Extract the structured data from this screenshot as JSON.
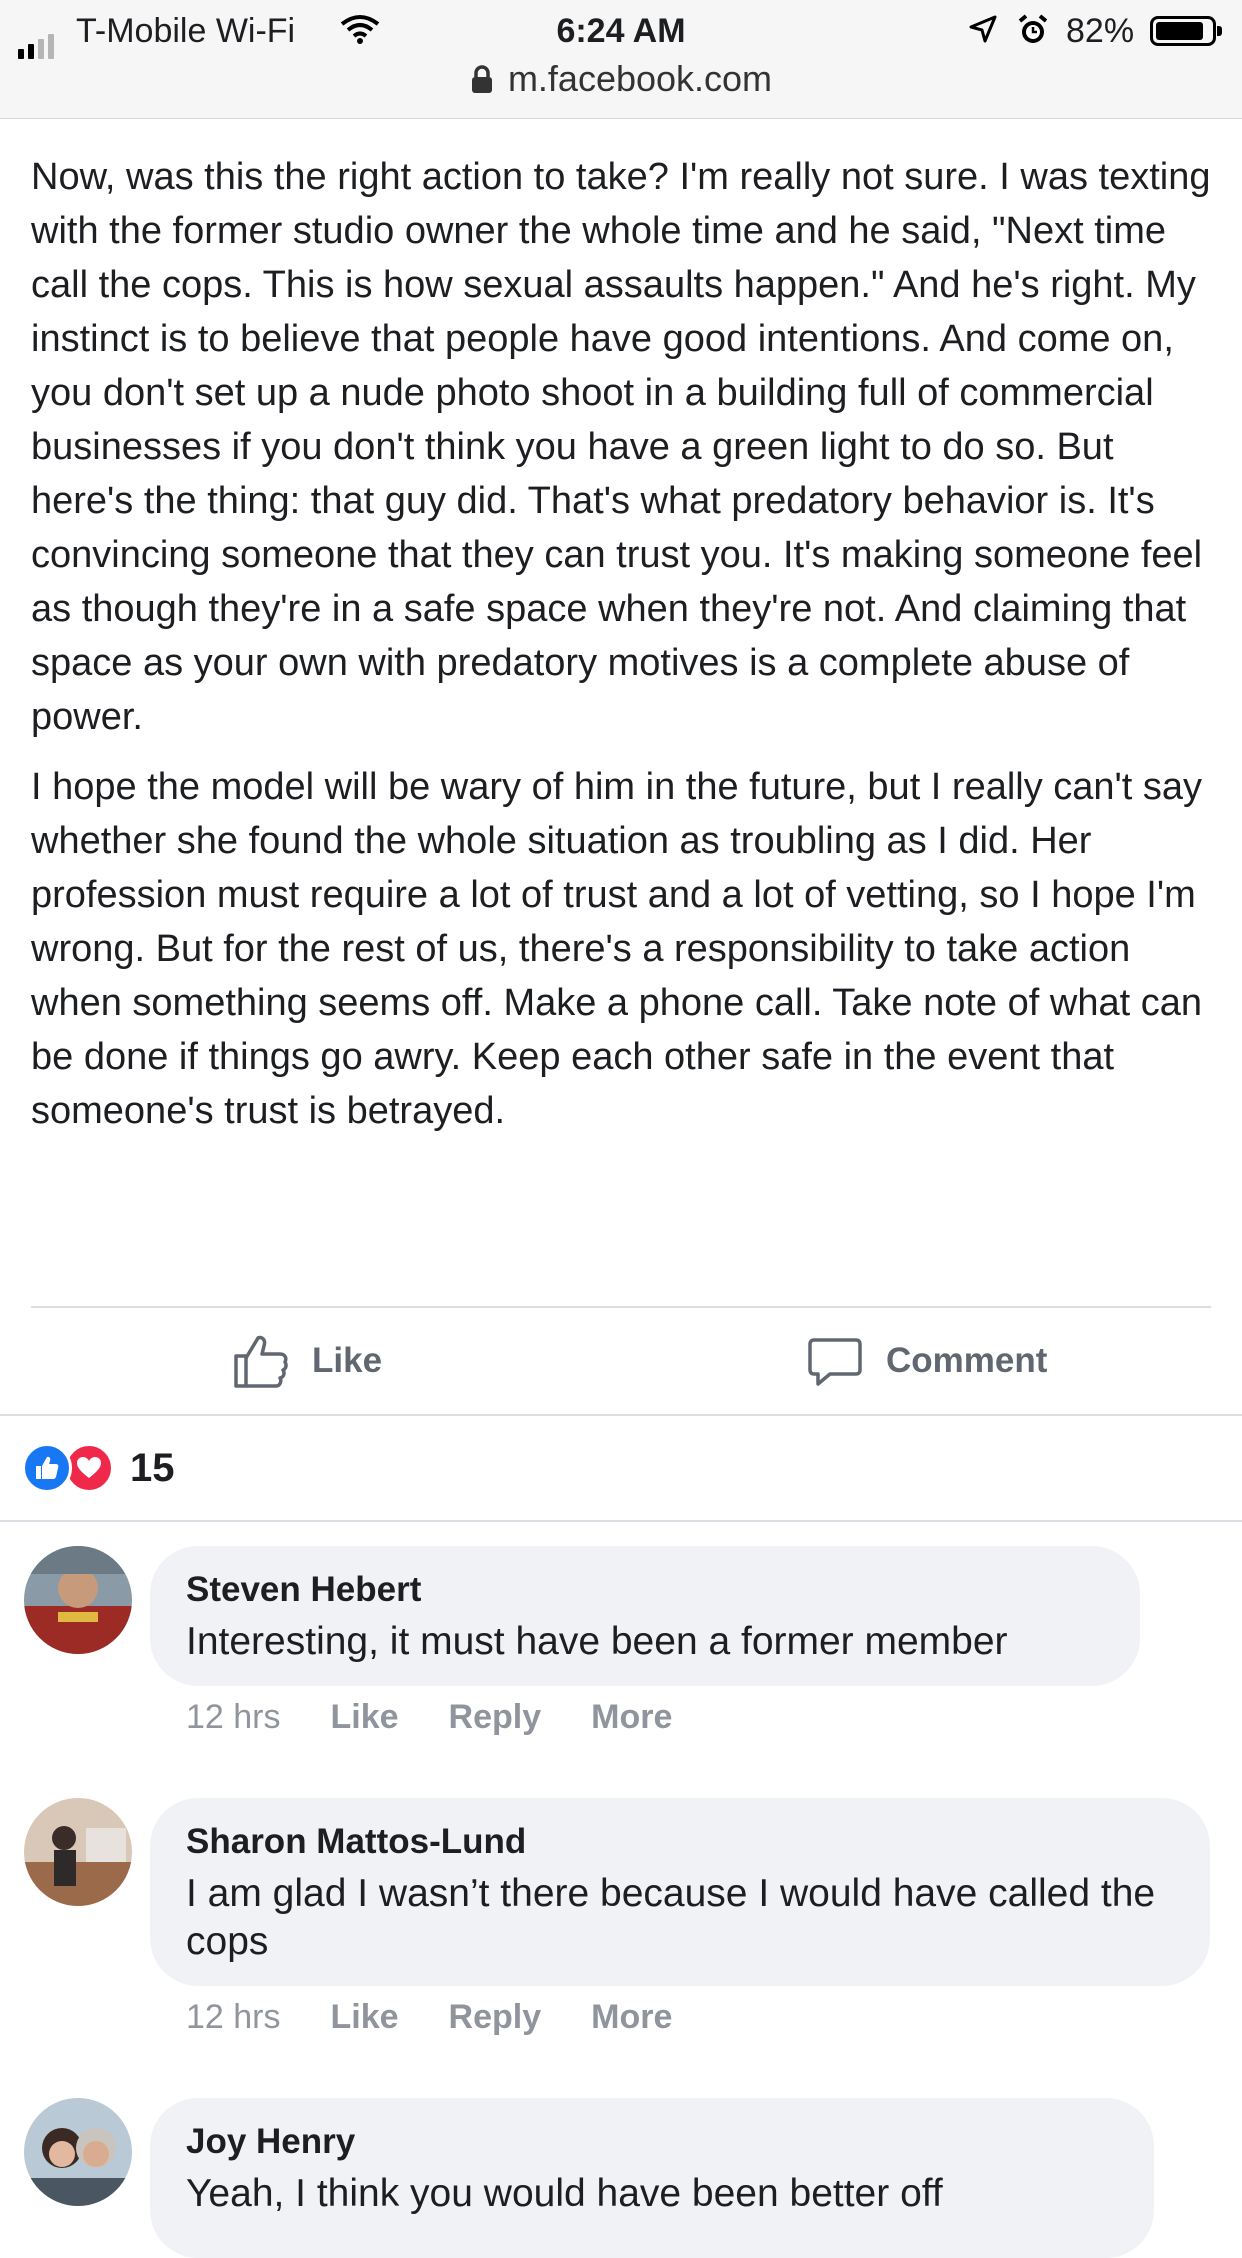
{
  "status_bar": {
    "carrier": "T-Mobile Wi-Fi",
    "time": "6:24 AM",
    "battery": "82%",
    "battery_level": 0.82,
    "url": "m.facebook.com",
    "icons": [
      "signal-icon",
      "wifi-icon",
      "location-icon",
      "alarm-icon",
      "battery-icon",
      "lock-icon"
    ]
  },
  "post": {
    "paragraphs": [
      "Now, was this the right action to take? I'm really not sure. I was texting with the former studio owner the whole time and he said, \"Next time call the cops. This is how sexual assaults happen.\" And he's right. My instinct is to believe that people have good intentions. And come on, you don't set up a nude photo shoot in a building full of commercial businesses if you don't think you have a green light to do so. But here's the thing: that guy did. That's what predatory behavior is. It's convincing someone that they can trust you. It's making someone feel as though they're in a safe space when they're not. And claiming that space as your own with predatory motives is a complete abuse of power.",
      "I hope the model will be wary of him in the future, but I really can't say whether she found the whole situation as troubling as I did. Her profession must require a lot of trust and a lot of vetting, so I hope I'm wrong. But for the rest of us, there's a responsibility to take action when something seems off. Make a phone call. Take note of what can be done if things go awry. Keep each other safe in the event that someone's trust is betrayed."
    ]
  },
  "actions": {
    "like_label": "Like",
    "comment_label": "Comment"
  },
  "reactions": {
    "count": "15",
    "types": [
      "like",
      "love"
    ],
    "colors": {
      "like": "#1877f2",
      "love": "#f0284a"
    }
  },
  "comments": [
    {
      "author": "Steven Hebert",
      "text": "Interesting, it must have been a former member",
      "time": "12 hrs",
      "like": "Like",
      "reply": "Reply",
      "more": "More"
    },
    {
      "author": "Sharon Mattos-Lund",
      "text": "I am glad I wasn’t there because I would have called the cops",
      "time": "12 hrs",
      "like": "Like",
      "reply": "Reply",
      "more": "More"
    },
    {
      "author": "Joy Henry",
      "text": "Yeah, I think you would have been better off"
    }
  ]
}
